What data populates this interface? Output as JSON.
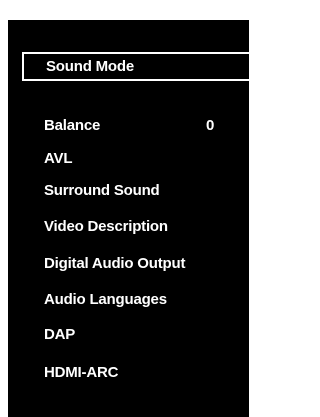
{
  "menu": {
    "items": [
      {
        "label": "Sound Mode",
        "selected": true
      },
      {
        "label": "Balance",
        "value": "0"
      },
      {
        "label": "AVL"
      },
      {
        "label": "Surround Sound"
      },
      {
        "label": "Video  Description"
      },
      {
        "label": "Digital  Audio Output"
      },
      {
        "label": "Audio Languages"
      },
      {
        "label": "DAP"
      },
      {
        "label": "HDMI-ARC"
      }
    ]
  },
  "colors": {
    "panel_background": "#000000",
    "text": "#ffffff",
    "selection_border": "#ffffff"
  }
}
